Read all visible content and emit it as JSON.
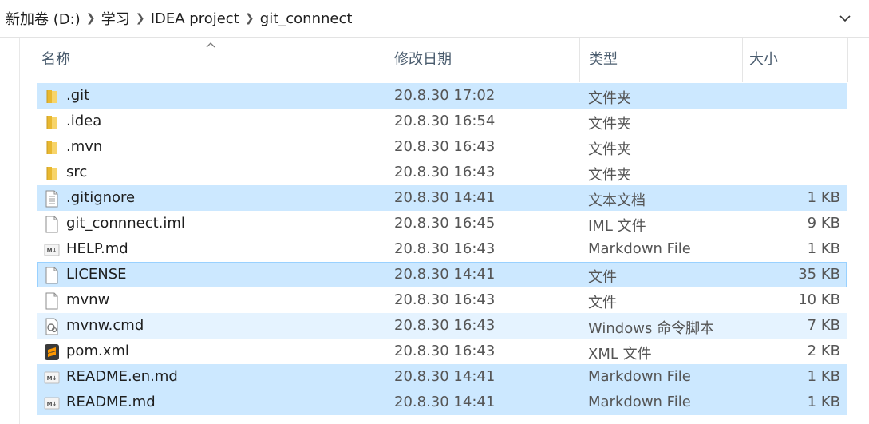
{
  "breadcrumb": [
    "新加卷 (D:)",
    "学习",
    "IDEA project",
    "git_connnect"
  ],
  "columns": {
    "name": "名称",
    "date": "修改日期",
    "type": "类型",
    "size": "大小"
  },
  "files": [
    {
      "name": ".git",
      "date": "20.8.30 17:02",
      "type": "文件夹",
      "size": "",
      "icon": "folder-icon",
      "state": "sel"
    },
    {
      "name": ".idea",
      "date": "20.8.30 16:54",
      "type": "文件夹",
      "size": "",
      "icon": "folder-icon",
      "state": ""
    },
    {
      "name": ".mvn",
      "date": "20.8.30 16:43",
      "type": "文件夹",
      "size": "",
      "icon": "folder-icon",
      "state": ""
    },
    {
      "name": "src",
      "date": "20.8.30 16:43",
      "type": "文件夹",
      "size": "",
      "icon": "folder-icon",
      "state": ""
    },
    {
      "name": ".gitignore",
      "date": "20.8.30 14:41",
      "type": "文本文档",
      "size": "1 KB",
      "icon": "text-file-icon",
      "state": "sel"
    },
    {
      "name": "git_connnect.iml",
      "date": "20.8.30 16:45",
      "type": "IML 文件",
      "size": "9 KB",
      "icon": "file-icon",
      "state": ""
    },
    {
      "name": "HELP.md",
      "date": "20.8.30 16:43",
      "type": "Markdown File",
      "size": "1 KB",
      "icon": "markdown-file-icon",
      "state": ""
    },
    {
      "name": "LICENSE",
      "date": "20.8.30 14:41",
      "type": "文件",
      "size": "35 KB",
      "icon": "file-icon",
      "state": "sel-b"
    },
    {
      "name": "mvnw",
      "date": "20.8.30 16:43",
      "type": "文件",
      "size": "10 KB",
      "icon": "file-icon",
      "state": ""
    },
    {
      "name": "mvnw.cmd",
      "date": "20.8.30 16:43",
      "type": "Windows 命令脚本",
      "size": "7 KB",
      "icon": "cmd-script-icon",
      "state": "hover"
    },
    {
      "name": "pom.xml",
      "date": "20.8.30 16:43",
      "type": "XML 文件",
      "size": "2 KB",
      "icon": "sublime-text-icon",
      "state": ""
    },
    {
      "name": "README.en.md",
      "date": "20.8.30 14:41",
      "type": "Markdown File",
      "size": "1 KB",
      "icon": "markdown-file-icon",
      "state": "sel"
    },
    {
      "name": "README.md",
      "date": "20.8.30 14:41",
      "type": "Markdown File",
      "size": "1 KB",
      "icon": "markdown-file-icon",
      "state": "sel"
    }
  ],
  "colors": {
    "selected": "#cce8ff",
    "hover": "#e5f3ff",
    "header_text": "#4a5c6e"
  }
}
